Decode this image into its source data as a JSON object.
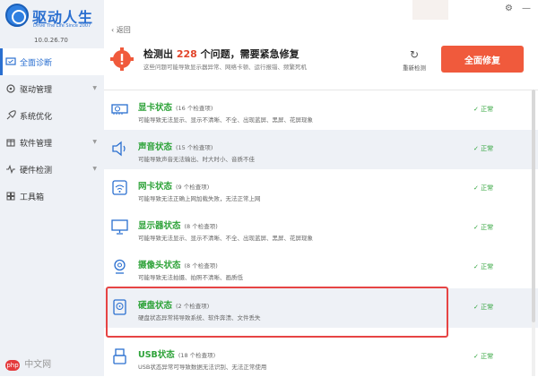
{
  "app": {
    "title": "驱动人生",
    "subtitle": "Drive The Life  Since 2007",
    "version": "10.0.26.70"
  },
  "sidebar": {
    "items": [
      {
        "label": "全面诊断",
        "active": true,
        "icon": "monitor-check-icon"
      },
      {
        "label": "驱动管理",
        "active": false,
        "icon": "driver-icon"
      },
      {
        "label": "系统优化",
        "active": false,
        "icon": "rocket-icon"
      },
      {
        "label": "软件管理",
        "active": false,
        "icon": "package-icon"
      },
      {
        "label": "硬件检测",
        "active": false,
        "icon": "pulse-icon"
      },
      {
        "label": "工具箱",
        "active": false,
        "icon": "toolbox-icon"
      }
    ]
  },
  "watermark": {
    "logo": "php",
    "text": "中文网"
  },
  "header": {
    "back_label": "返回"
  },
  "alert": {
    "title_prefix": "检测出",
    "count": "228",
    "title_suffix": "个问题，需要紧急修复",
    "desc": "这些问题可能导致显示器异常、网络卡顿、运行报错、频繁死机",
    "refresh_label": "重新检测",
    "fix_label": "全面修复"
  },
  "rows": [
    {
      "name": "显卡状态",
      "count": "(16 个检查项)",
      "desc": "可能导致无法显示、显示不清晰、不全、出现蓝屏、黑屏、花屏现象",
      "status": "正常",
      "icon": "graphics-card-icon"
    },
    {
      "name": "声音状态",
      "count": "(15 个检查项)",
      "desc": "可能导致声音无法输出、时大时小、音质不佳",
      "status": "正常",
      "icon": "speaker-icon"
    },
    {
      "name": "网卡状态",
      "count": "(9 个检查项)",
      "desc": "可能导致无法正确上网加载失败，无法正常上网",
      "status": "正常",
      "icon": "wifi-icon"
    },
    {
      "name": "显示器状态",
      "count": "(8 个检查项)",
      "desc": "可能导致无法显示、显示不清晰、不全、出现蓝屏、黑屏、花屏现象",
      "status": "正常",
      "icon": "monitor-icon"
    },
    {
      "name": "摄像头状态",
      "count": "(8 个检查项)",
      "desc": "可能导致无法拍摄、拍照不清晰、画质低",
      "status": "正常",
      "icon": "webcam-icon"
    },
    {
      "name": "硬盘状态",
      "count": "(2 个检查项)",
      "desc": "硬盘状态异常将导致系统、软件奔溃、文件丢失",
      "status": "正常",
      "icon": "hard-disk-icon"
    },
    {
      "name": "USB状态",
      "count": "(18 个检查项)",
      "desc": "USB状态异常可导致数据无法识别、无法正常使用",
      "status": "正常",
      "icon": "usb-icon"
    }
  ],
  "colors": {
    "accent": "#2a6fd0",
    "ok": "#2fa33a",
    "danger": "#f05a3c",
    "highlight": "#e64444"
  }
}
